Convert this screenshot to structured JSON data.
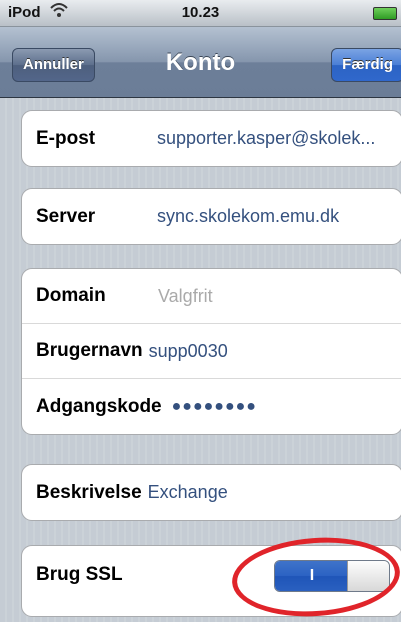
{
  "status_bar": {
    "carrier": "iPod",
    "time": "10.23"
  },
  "nav": {
    "title": "Konto",
    "cancel_label": "Annuller",
    "done_label": "Færdig"
  },
  "rows": {
    "email": {
      "label": "E-post",
      "value": "supporter.kasper@skolek..."
    },
    "server": {
      "label": "Server",
      "value": "sync.skolekom.emu.dk"
    },
    "domain": {
      "label": "Domain",
      "placeholder": "Valgfrit"
    },
    "username": {
      "label": "Brugernavn",
      "value": "supp0030"
    },
    "password": {
      "label": "Adgangskode",
      "value": "●●●●●●●●"
    },
    "description": {
      "label": "Beskrivelse",
      "value": "Exchange"
    },
    "ssl": {
      "label": "Brug SSL",
      "toggle_on_label": "I"
    }
  },
  "colors": {
    "annotation": "#e0242a",
    "value_text": "#34507e"
  }
}
